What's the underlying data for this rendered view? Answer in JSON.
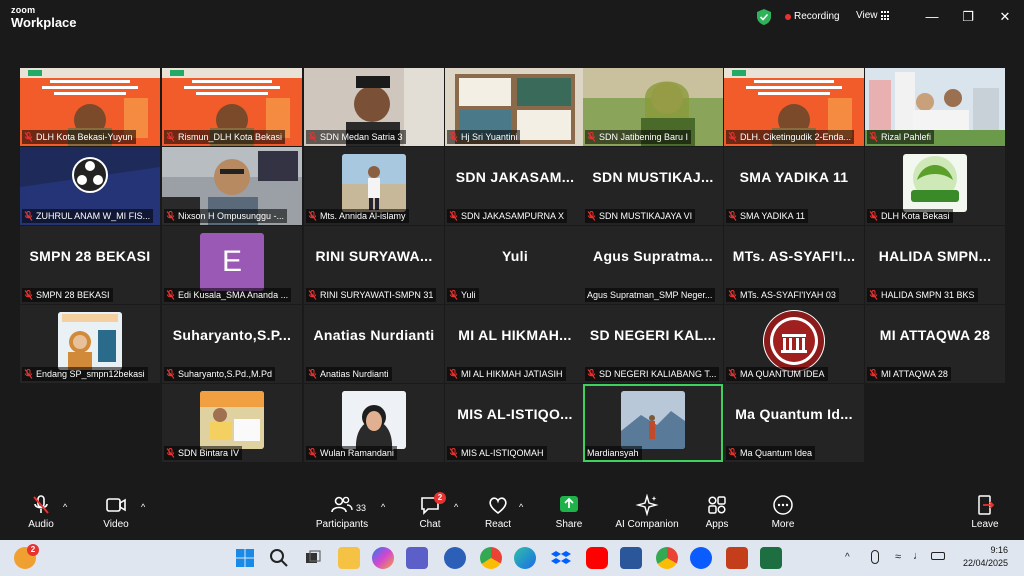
{
  "app": {
    "logo_line1": "zoom",
    "logo_line2": "Workplace"
  },
  "titlebar": {
    "recording_label": "Recording",
    "view_label": "View"
  },
  "participants": [
    {
      "label": "DLH Kota Bekasi-Yuyun",
      "big": ""
    },
    {
      "label": "Rismun_DLH Kota Bekasi",
      "big": ""
    },
    {
      "label": "SDN Medan Satria 3",
      "big": ""
    },
    {
      "label": "Hj Sri Yuantini",
      "big": ""
    },
    {
      "label": "SDN Jatibening Baru I",
      "big": ""
    },
    {
      "label": "DLH. Ciketingudik 2-Enda...",
      "big": ""
    },
    {
      "label": "Rizal Pahlefi",
      "big": ""
    },
    {
      "label": "ZUHRUL ANAM W_MI FIS...",
      "big": ""
    },
    {
      "label": "Nixson H Ompusunggu -...",
      "big": ""
    },
    {
      "label": "Mts. Annida Al-islamy",
      "big": ""
    },
    {
      "label": "SDN JAKASAMPURNA X",
      "big": "SDN JAKASAM..."
    },
    {
      "label": "SDN MUSTIKAJAYA VI",
      "big": "SDN MUSTIKAJ..."
    },
    {
      "label": "SMA YADIKA 11",
      "big": "SMA YADIKA 11"
    },
    {
      "label": "DLH Kota Bekasi",
      "big": ""
    },
    {
      "label": "SMPN 28 BEKASI",
      "big": "SMPN 28 BEKASI"
    },
    {
      "label": "Edi Kusala_SMA Ananda ...",
      "big": ""
    },
    {
      "label": "RINI SURYAWATI-SMPN 31",
      "big": "RINI SURYAWA..."
    },
    {
      "label": "Yuli",
      "big": "Yuli"
    },
    {
      "label": "Agus Supratman_SMP Neger...",
      "big": "Agus Supratma..."
    },
    {
      "label": "MTs. AS-SYAFI'IYAH 03",
      "big": "MTs. AS-SYAFI'I..."
    },
    {
      "label": "HALIDA SMPN 31 BKS",
      "big": "HALIDA SMPN..."
    },
    {
      "label": "Endang SP_smpn12bekasi",
      "big": ""
    },
    {
      "label": "Suharyanto,S.Pd.,M.Pd",
      "big": "Suharyanto,S.P..."
    },
    {
      "label": "Anatias Nurdianti",
      "big": "Anatias Nurdianti"
    },
    {
      "label": "MI AL HIKMAH JATIASIH",
      "big": "MI AL HIKMAH..."
    },
    {
      "label": "SD NEGERI KALIABANG T...",
      "big": "SD NEGERI KAL..."
    },
    {
      "label": "MA QUANTUM IDEA",
      "big": ""
    },
    {
      "label": "MI ATTAQWA 28",
      "big": "MI ATTAQWA 28"
    },
    {
      "label": "SDN Bintara IV",
      "big": ""
    },
    {
      "label": "Wulan Ramandani",
      "big": ""
    },
    {
      "label": "MIS AL-ISTIQOMAH",
      "big": "MIS AL-ISTIQO..."
    },
    {
      "label": "Mardiansyah",
      "big": ""
    },
    {
      "label": "Ma Quantum Idea",
      "big": "Ma Quantum Id..."
    }
  ],
  "avatar_letter": "E",
  "toolbar": {
    "audio": "Audio",
    "video": "Video",
    "participants": "Participants",
    "participants_count": "33",
    "chat": "Chat",
    "chat_badge": "2",
    "react": "React",
    "share": "Share",
    "ai_companion": "AI Companion",
    "apps": "Apps",
    "more": "More",
    "leave": "Leave"
  },
  "taskbar": {
    "time": "9:16",
    "date": "22/04/2025",
    "notif_badge": "2"
  },
  "colors": {
    "accent_green": "#3fd15e",
    "share_green": "#1fb14a",
    "record_red": "#e8322f",
    "leave_red": "#e8322f"
  }
}
